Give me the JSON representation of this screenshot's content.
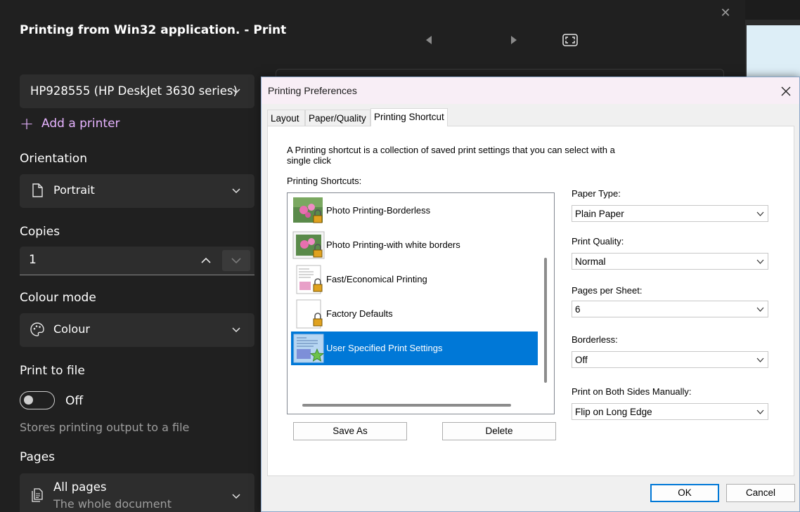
{
  "print_panel": {
    "title": "Printing from Win32 application. - Print",
    "printer": "HP928555 (HP DeskJet 3630 series)",
    "add_printer": "Add a printer",
    "orientation_label": "Orientation",
    "orientation_value": "Portrait",
    "copies_label": "Copies",
    "copies_value": "1",
    "colour_mode_label": "Colour mode",
    "colour_mode_value": "Colour",
    "print_to_file_label": "Print to file",
    "print_to_file_state": "Off",
    "print_to_file_hint": "Stores printing output to a file",
    "pages_label": "Pages",
    "pages_value": "All pages",
    "pages_subtext": "The whole document"
  },
  "dialog": {
    "title": "Printing Preferences",
    "tabs": [
      {
        "label": "Layout"
      },
      {
        "label": "Paper/Quality"
      },
      {
        "label": "Printing Shortcut"
      }
    ],
    "active_tab": "Printing Shortcut",
    "description": "A Printing shortcut is a collection of saved print settings that you can select with a single click",
    "shortcuts_label": "Printing Shortcuts:",
    "shortcuts": [
      {
        "label": "Photo Printing-Borderless",
        "icon": "photo-lock-icon"
      },
      {
        "label": "Photo Printing-with white borders",
        "icon": "photo-bordered-lock-icon"
      },
      {
        "label": "Fast/Economical Printing",
        "icon": "document-lock-icon"
      },
      {
        "label": "Factory Defaults",
        "icon": "blank-page-lock-icon"
      },
      {
        "label": "User Specified Print Settings",
        "icon": "document-star-icon",
        "selected": true
      }
    ],
    "save_as_label": "Save As",
    "delete_label": "Delete",
    "paper_type_label": "Paper Type:",
    "paper_type_value": "Plain Paper",
    "print_quality_label": "Print Quality:",
    "print_quality_value": "Normal",
    "pages_per_sheet_label": "Pages per Sheet:",
    "pages_per_sheet_value": "6",
    "borderless_label": "Borderless:",
    "borderless_value": "Off",
    "duplex_label": "Print on Both Sides Manually:",
    "duplex_value": "Flip on Long Edge",
    "ok_label": "OK",
    "cancel_label": "Cancel"
  },
  "colors": {
    "accent": "#0078d7",
    "link": "#e6b3ff",
    "dark_bg": "#202020"
  }
}
